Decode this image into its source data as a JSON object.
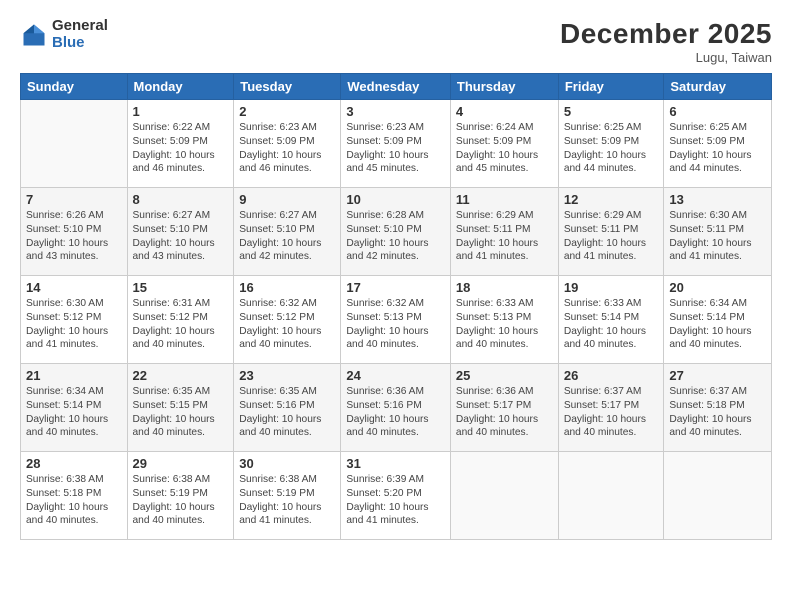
{
  "logo": {
    "general": "General",
    "blue": "Blue"
  },
  "header": {
    "month": "December 2025",
    "location": "Lugu, Taiwan"
  },
  "weekdays": [
    "Sunday",
    "Monday",
    "Tuesday",
    "Wednesday",
    "Thursday",
    "Friday",
    "Saturday"
  ],
  "weeks": [
    [
      {
        "day": "",
        "info": ""
      },
      {
        "day": "1",
        "info": "Sunrise: 6:22 AM\nSunset: 5:09 PM\nDaylight: 10 hours\nand 46 minutes."
      },
      {
        "day": "2",
        "info": "Sunrise: 6:23 AM\nSunset: 5:09 PM\nDaylight: 10 hours\nand 46 minutes."
      },
      {
        "day": "3",
        "info": "Sunrise: 6:23 AM\nSunset: 5:09 PM\nDaylight: 10 hours\nand 45 minutes."
      },
      {
        "day": "4",
        "info": "Sunrise: 6:24 AM\nSunset: 5:09 PM\nDaylight: 10 hours\nand 45 minutes."
      },
      {
        "day": "5",
        "info": "Sunrise: 6:25 AM\nSunset: 5:09 PM\nDaylight: 10 hours\nand 44 minutes."
      },
      {
        "day": "6",
        "info": "Sunrise: 6:25 AM\nSunset: 5:09 PM\nDaylight: 10 hours\nand 44 minutes."
      }
    ],
    [
      {
        "day": "7",
        "info": "Sunrise: 6:26 AM\nSunset: 5:10 PM\nDaylight: 10 hours\nand 43 minutes."
      },
      {
        "day": "8",
        "info": "Sunrise: 6:27 AM\nSunset: 5:10 PM\nDaylight: 10 hours\nand 43 minutes."
      },
      {
        "day": "9",
        "info": "Sunrise: 6:27 AM\nSunset: 5:10 PM\nDaylight: 10 hours\nand 42 minutes."
      },
      {
        "day": "10",
        "info": "Sunrise: 6:28 AM\nSunset: 5:10 PM\nDaylight: 10 hours\nand 42 minutes."
      },
      {
        "day": "11",
        "info": "Sunrise: 6:29 AM\nSunset: 5:11 PM\nDaylight: 10 hours\nand 41 minutes."
      },
      {
        "day": "12",
        "info": "Sunrise: 6:29 AM\nSunset: 5:11 PM\nDaylight: 10 hours\nand 41 minutes."
      },
      {
        "day": "13",
        "info": "Sunrise: 6:30 AM\nSunset: 5:11 PM\nDaylight: 10 hours\nand 41 minutes."
      }
    ],
    [
      {
        "day": "14",
        "info": "Sunrise: 6:30 AM\nSunset: 5:12 PM\nDaylight: 10 hours\nand 41 minutes."
      },
      {
        "day": "15",
        "info": "Sunrise: 6:31 AM\nSunset: 5:12 PM\nDaylight: 10 hours\nand 40 minutes."
      },
      {
        "day": "16",
        "info": "Sunrise: 6:32 AM\nSunset: 5:12 PM\nDaylight: 10 hours\nand 40 minutes."
      },
      {
        "day": "17",
        "info": "Sunrise: 6:32 AM\nSunset: 5:13 PM\nDaylight: 10 hours\nand 40 minutes."
      },
      {
        "day": "18",
        "info": "Sunrise: 6:33 AM\nSunset: 5:13 PM\nDaylight: 10 hours\nand 40 minutes."
      },
      {
        "day": "19",
        "info": "Sunrise: 6:33 AM\nSunset: 5:14 PM\nDaylight: 10 hours\nand 40 minutes."
      },
      {
        "day": "20",
        "info": "Sunrise: 6:34 AM\nSunset: 5:14 PM\nDaylight: 10 hours\nand 40 minutes."
      }
    ],
    [
      {
        "day": "21",
        "info": "Sunrise: 6:34 AM\nSunset: 5:14 PM\nDaylight: 10 hours\nand 40 minutes."
      },
      {
        "day": "22",
        "info": "Sunrise: 6:35 AM\nSunset: 5:15 PM\nDaylight: 10 hours\nand 40 minutes."
      },
      {
        "day": "23",
        "info": "Sunrise: 6:35 AM\nSunset: 5:16 PM\nDaylight: 10 hours\nand 40 minutes."
      },
      {
        "day": "24",
        "info": "Sunrise: 6:36 AM\nSunset: 5:16 PM\nDaylight: 10 hours\nand 40 minutes."
      },
      {
        "day": "25",
        "info": "Sunrise: 6:36 AM\nSunset: 5:17 PM\nDaylight: 10 hours\nand 40 minutes."
      },
      {
        "day": "26",
        "info": "Sunrise: 6:37 AM\nSunset: 5:17 PM\nDaylight: 10 hours\nand 40 minutes."
      },
      {
        "day": "27",
        "info": "Sunrise: 6:37 AM\nSunset: 5:18 PM\nDaylight: 10 hours\nand 40 minutes."
      }
    ],
    [
      {
        "day": "28",
        "info": "Sunrise: 6:38 AM\nSunset: 5:18 PM\nDaylight: 10 hours\nand 40 minutes."
      },
      {
        "day": "29",
        "info": "Sunrise: 6:38 AM\nSunset: 5:19 PM\nDaylight: 10 hours\nand 40 minutes."
      },
      {
        "day": "30",
        "info": "Sunrise: 6:38 AM\nSunset: 5:19 PM\nDaylight: 10 hours\nand 41 minutes."
      },
      {
        "day": "31",
        "info": "Sunrise: 6:39 AM\nSunset: 5:20 PM\nDaylight: 10 hours\nand 41 minutes."
      },
      {
        "day": "",
        "info": ""
      },
      {
        "day": "",
        "info": ""
      },
      {
        "day": "",
        "info": ""
      }
    ]
  ]
}
